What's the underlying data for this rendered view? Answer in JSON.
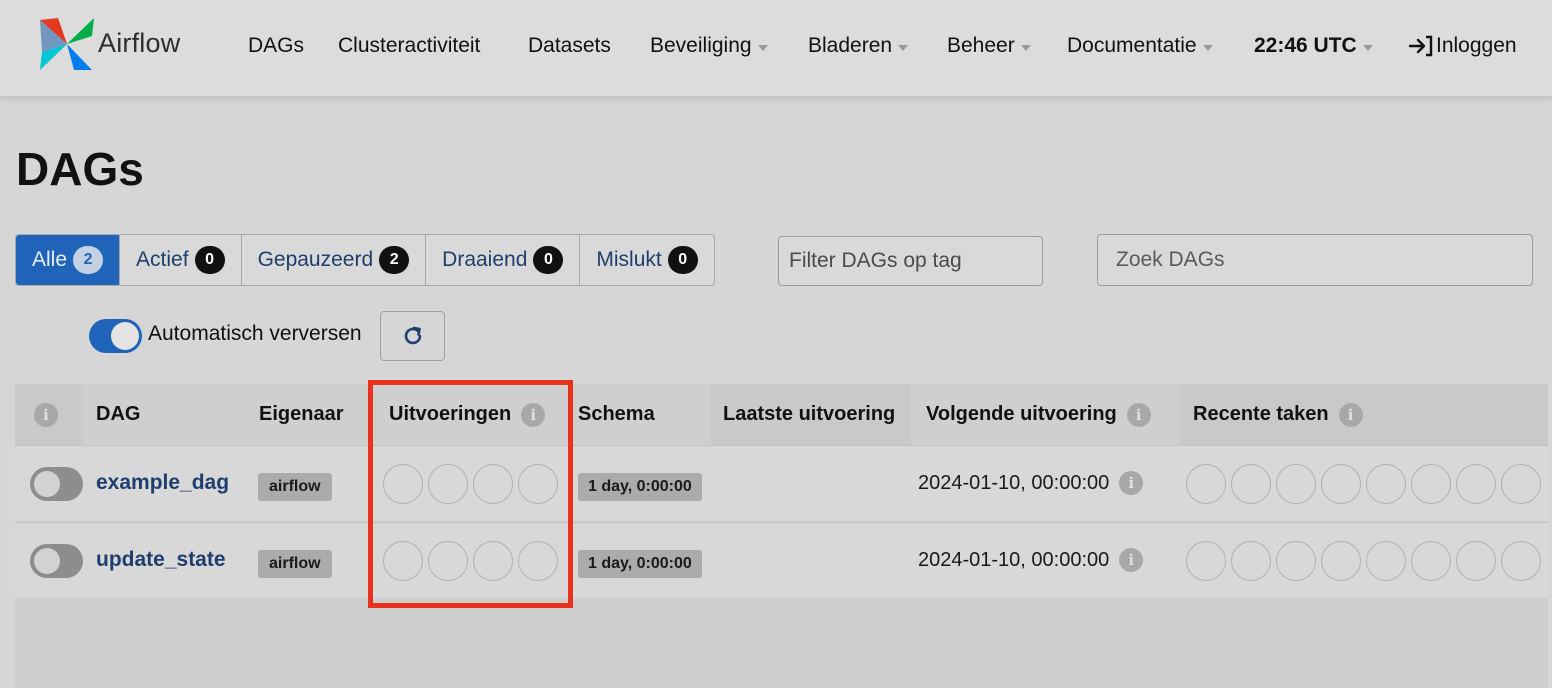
{
  "navbar": {
    "brand": "Airflow",
    "items": [
      {
        "label": "DAGs",
        "dropdown": false
      },
      {
        "label": "Clusteractiviteit",
        "dropdown": false
      },
      {
        "label": "Datasets",
        "dropdown": false
      },
      {
        "label": "Beveiliging",
        "dropdown": true
      },
      {
        "label": "Bladeren",
        "dropdown": true
      },
      {
        "label": "Beheer",
        "dropdown": true
      },
      {
        "label": "Documentatie",
        "dropdown": true
      }
    ],
    "time": "22:46 UTC",
    "login": "Inloggen"
  },
  "page": {
    "title": "DAGs"
  },
  "filters": {
    "all": {
      "label": "Alle",
      "count": "2"
    },
    "active": {
      "label": "Actief",
      "count": "0"
    },
    "paused": {
      "label": "Gepauzeerd",
      "count": "2"
    },
    "running": {
      "label": "Draaiend",
      "count": "0"
    },
    "failed": {
      "label": "Mislukt",
      "count": "0"
    },
    "tag_placeholder": "Filter DAGs op tag",
    "search_placeholder": "Zoek DAGs"
  },
  "auto_refresh": {
    "label": "Automatisch verversen",
    "enabled": true
  },
  "table": {
    "headers": {
      "dag": "DAG",
      "owner": "Eigenaar",
      "runs": "Uitvoeringen",
      "schedule": "Schema",
      "last_run": "Laatste uitvoering",
      "next_run": "Volgende uitvoering",
      "recent_tasks": "Recente taken"
    },
    "rows": [
      {
        "dag_id": "example_dag",
        "owner": "airflow",
        "schedule": "1 day, 0:00:00",
        "next_run": "2024-01-10, 00:00:00",
        "paused": true
      },
      {
        "dag_id": "update_state",
        "owner": "airflow",
        "schedule": "1 day, 0:00:00",
        "next_run": "2024-01-10, 00:00:00",
        "paused": true
      }
    ]
  },
  "colors": {
    "primary": "#1f64b8",
    "link": "#1f3e6e",
    "highlight": "#e8321e"
  }
}
